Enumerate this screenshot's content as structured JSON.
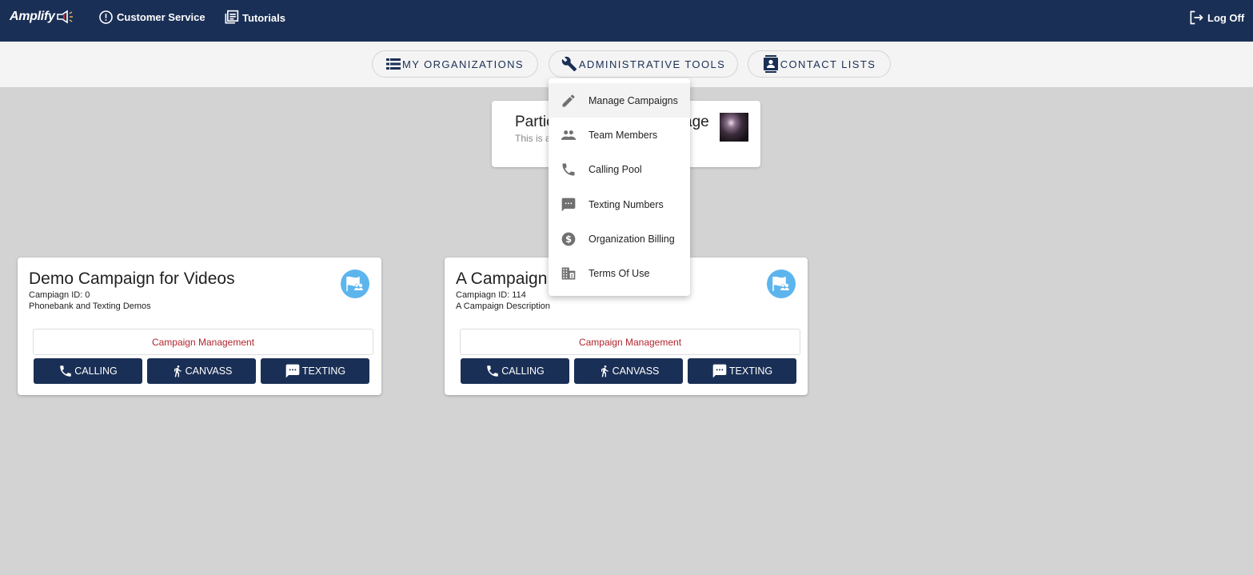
{
  "topbar": {
    "logo_text": "Amplify",
    "links": [
      {
        "label": "Customer Service",
        "icon": "alert-circle-icon"
      },
      {
        "label": "Tutorials",
        "icon": "library-books-icon"
      }
    ],
    "logoff_label": "Log Off"
  },
  "subnav": {
    "tabs": [
      {
        "label": "MY ORGANIZATIONS",
        "icon": "list-icon"
      },
      {
        "label": "ADMINISTRATIVE TOOLS",
        "icon": "wrench-icon"
      },
      {
        "label": "CONTACT LISTS",
        "icon": "contacts-icon"
      }
    ]
  },
  "admin_menu": {
    "items": [
      {
        "label": "Manage Campaigns",
        "icon": "pencil-icon",
        "active": true
      },
      {
        "label": "Team Members",
        "icon": "people-icon"
      },
      {
        "label": "Calling Pool",
        "icon": "phone-icon"
      },
      {
        "label": "Texting Numbers",
        "icon": "sms-icon"
      },
      {
        "label": "Organization Billing",
        "icon": "dollar-icon"
      },
      {
        "label": "Terms Of Use",
        "icon": "building-icon"
      }
    ]
  },
  "organization": {
    "title_visible_start": "Partic",
    "title_visible_end": "age",
    "subtitle_visible": "This is a"
  },
  "campaigns": [
    {
      "title": "Demo Campaign for Videos",
      "id_text": "Campiagn ID: 0",
      "description": "Phonebank and Texting Demos",
      "management_label": "Campaign Management",
      "actions": [
        "CALLING",
        "CANVASS",
        "TEXTING"
      ]
    },
    {
      "title": "A Campaign",
      "id_text": "Campiagn ID: 114",
      "description": "A Campaign Description",
      "management_label": "Campaign Management",
      "actions": [
        "CALLING",
        "CANVASS",
        "TEXTING"
      ]
    }
  ],
  "colors": {
    "navy": "#1a2f55",
    "management_text": "#b0262d",
    "campaign_icon_bg": "#5db5ee",
    "page_bg": "#d3d3d3"
  }
}
